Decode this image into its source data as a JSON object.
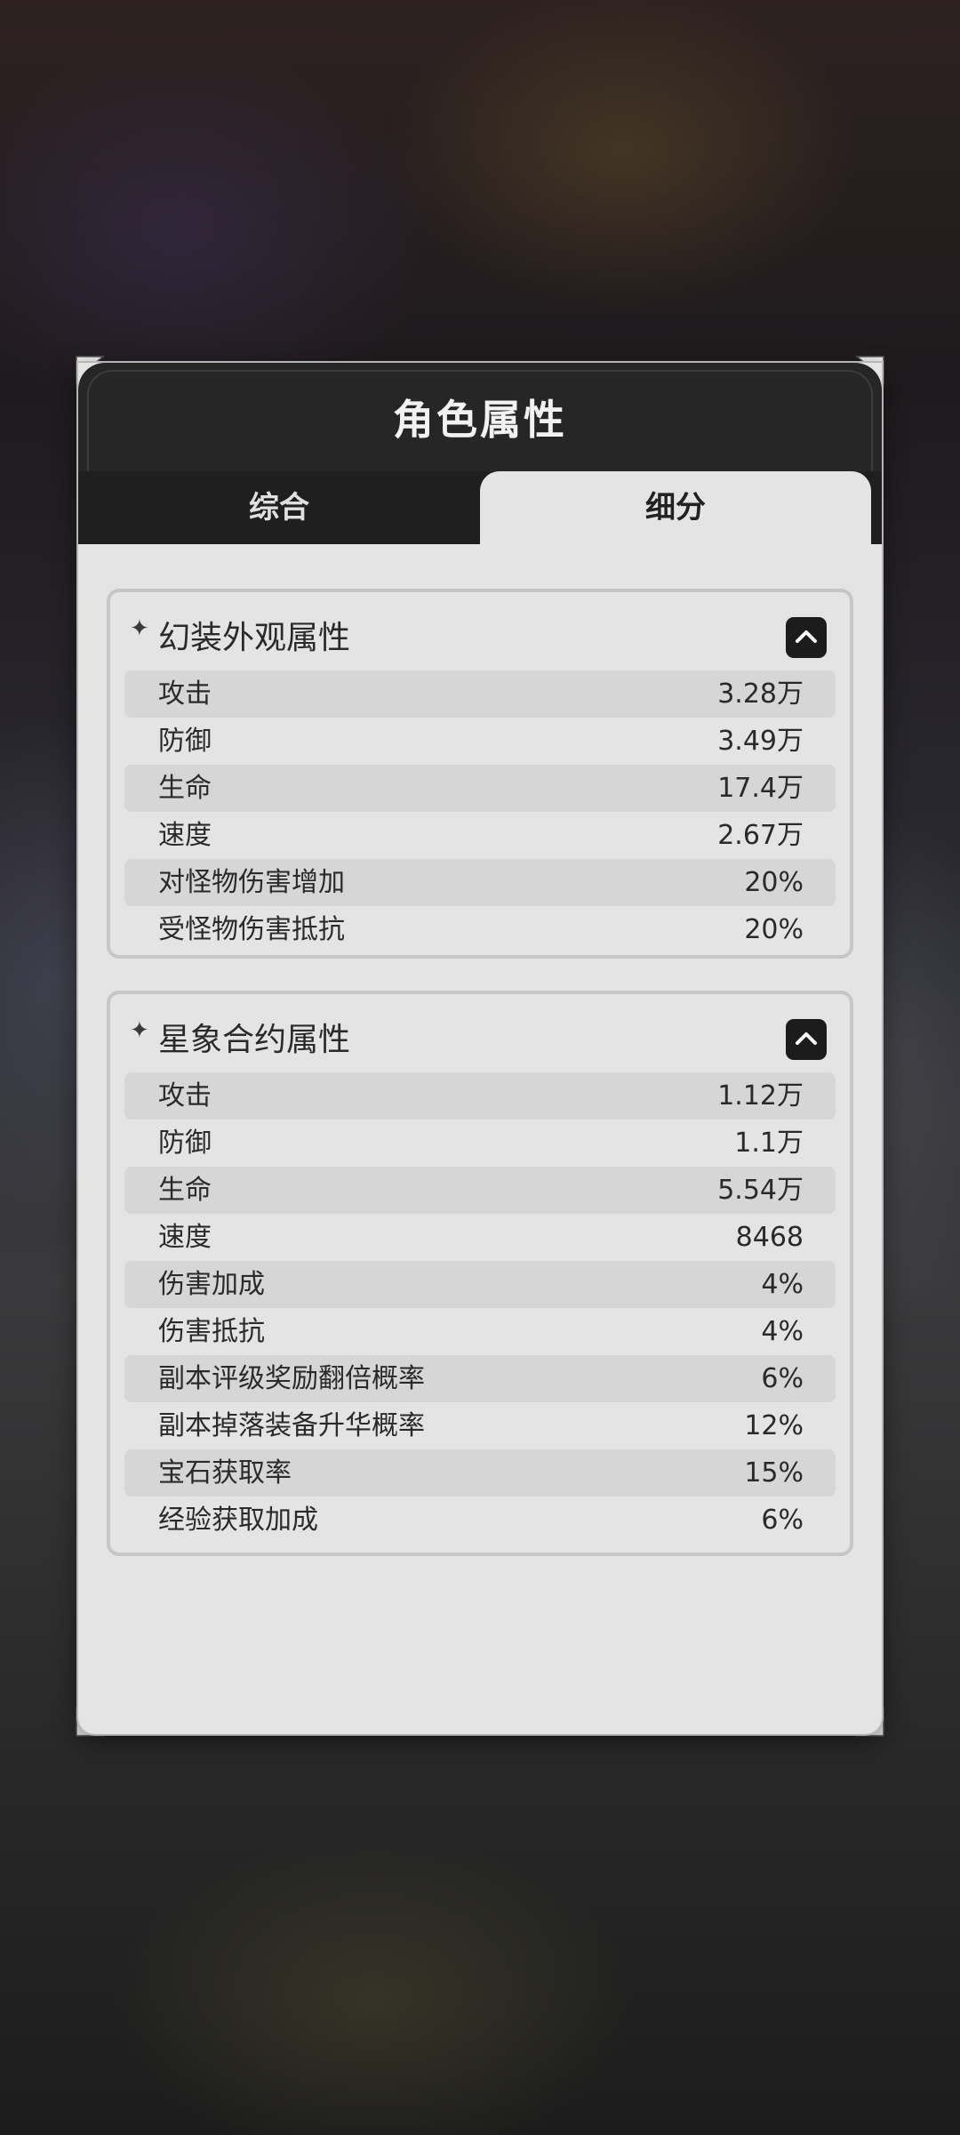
{
  "panel": {
    "title": "角色属性",
    "tabs": [
      {
        "label": "综合",
        "active": false
      },
      {
        "label": "细分",
        "active": true
      }
    ]
  },
  "sections": [
    {
      "title": "幻装外观属性",
      "expanded": true,
      "rows": [
        {
          "label": "攻击",
          "value": "3.28万"
        },
        {
          "label": "防御",
          "value": "3.49万"
        },
        {
          "label": "生命",
          "value": "17.4万"
        },
        {
          "label": "速度",
          "value": "2.67万"
        },
        {
          "label": "对怪物伤害增加",
          "value": "20%"
        },
        {
          "label": "受怪物伤害抵抗",
          "value": "20%"
        }
      ]
    },
    {
      "title": "星象合约属性",
      "expanded": true,
      "rows": [
        {
          "label": "攻击",
          "value": "1.12万"
        },
        {
          "label": "防御",
          "value": "1.1万"
        },
        {
          "label": "生命",
          "value": "5.54万"
        },
        {
          "label": "速度",
          "value": "8468"
        },
        {
          "label": "伤害加成",
          "value": "4%"
        },
        {
          "label": "伤害抵抗",
          "value": "4%"
        },
        {
          "label": "副本评级奖励翻倍概率",
          "value": "6%"
        },
        {
          "label": "副本掉落装备升华概率",
          "value": "12%"
        },
        {
          "label": "宝石获取率",
          "value": "15%"
        },
        {
          "label": "经验获取加成",
          "value": "6%"
        }
      ]
    }
  ],
  "colors": {
    "header_bg": "#262626",
    "panel_bg": "#e4e4e4",
    "row_alt_bg": "#d6d6d6",
    "text": "#2a2a2a"
  },
  "icons": {
    "section_marker": "sparkle-icon",
    "collapse": "chevron-up-icon",
    "corners": "corner-ornament-icon"
  }
}
